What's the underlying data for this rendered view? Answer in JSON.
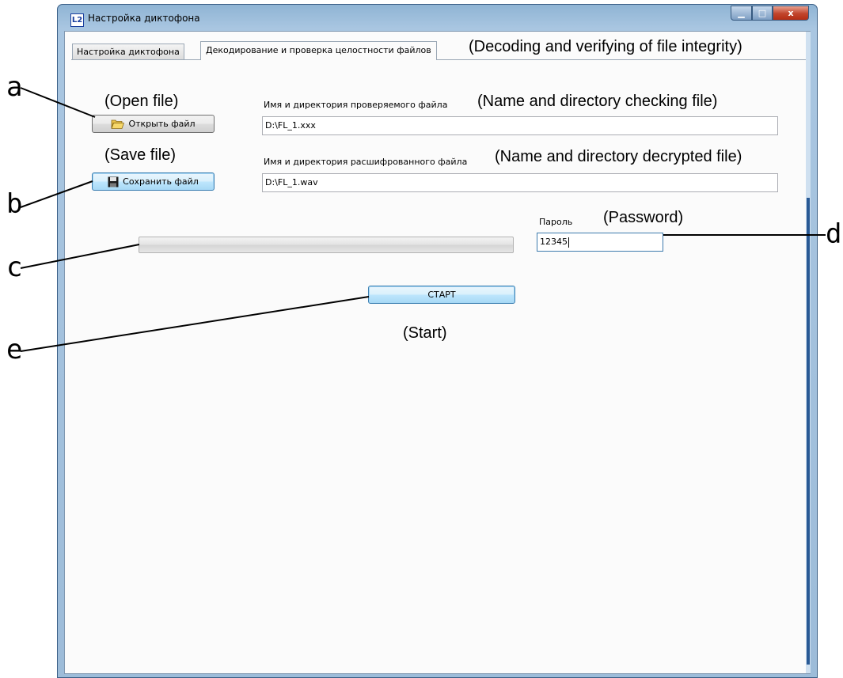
{
  "window": {
    "title": "Настройка диктофона",
    "app_icon_glyph": "L2",
    "caption_buttons": {
      "minimize": "▁",
      "maximize": "□",
      "close": "x"
    }
  },
  "tabs": [
    {
      "label": "Настройка диктофона",
      "active": false
    },
    {
      "label": "Декодирование и проверка целостности файлов",
      "active": true
    }
  ],
  "form": {
    "open_button_label": "Открыть файл",
    "open_button_icon": "folder-open-icon",
    "checked_file_label": "Имя и директория проверяемого файла",
    "checked_file_value": "D:\\FL_1.xxx",
    "save_button_label": "Сохранить файл",
    "save_button_icon": "floppy-disk-icon",
    "decrypted_file_label": "Имя и директория расшифрованного файла",
    "decrypted_file_value": "D:\\FL_1.wav",
    "password_label": "Пароль",
    "password_value": "12345",
    "progress_fraction": 0,
    "start_button_label": "СТАРТ"
  },
  "annotations": {
    "tab_translation": "(Decoding and verifying of file integrity)",
    "open_file": "(Open file)",
    "checked_file": "(Name and directory checking file)",
    "save_file": "(Save file)",
    "decrypted_file": "(Name and directory decrypted file)",
    "password": "(Password)",
    "start": "(Start)",
    "letters": {
      "a": "a",
      "b": "b",
      "c": "c",
      "d": "d",
      "e": "e"
    }
  },
  "colors": {
    "window_frame": "#9dbcd9",
    "close_button": "#c1442b",
    "focus_border": "#3c7fb1"
  }
}
